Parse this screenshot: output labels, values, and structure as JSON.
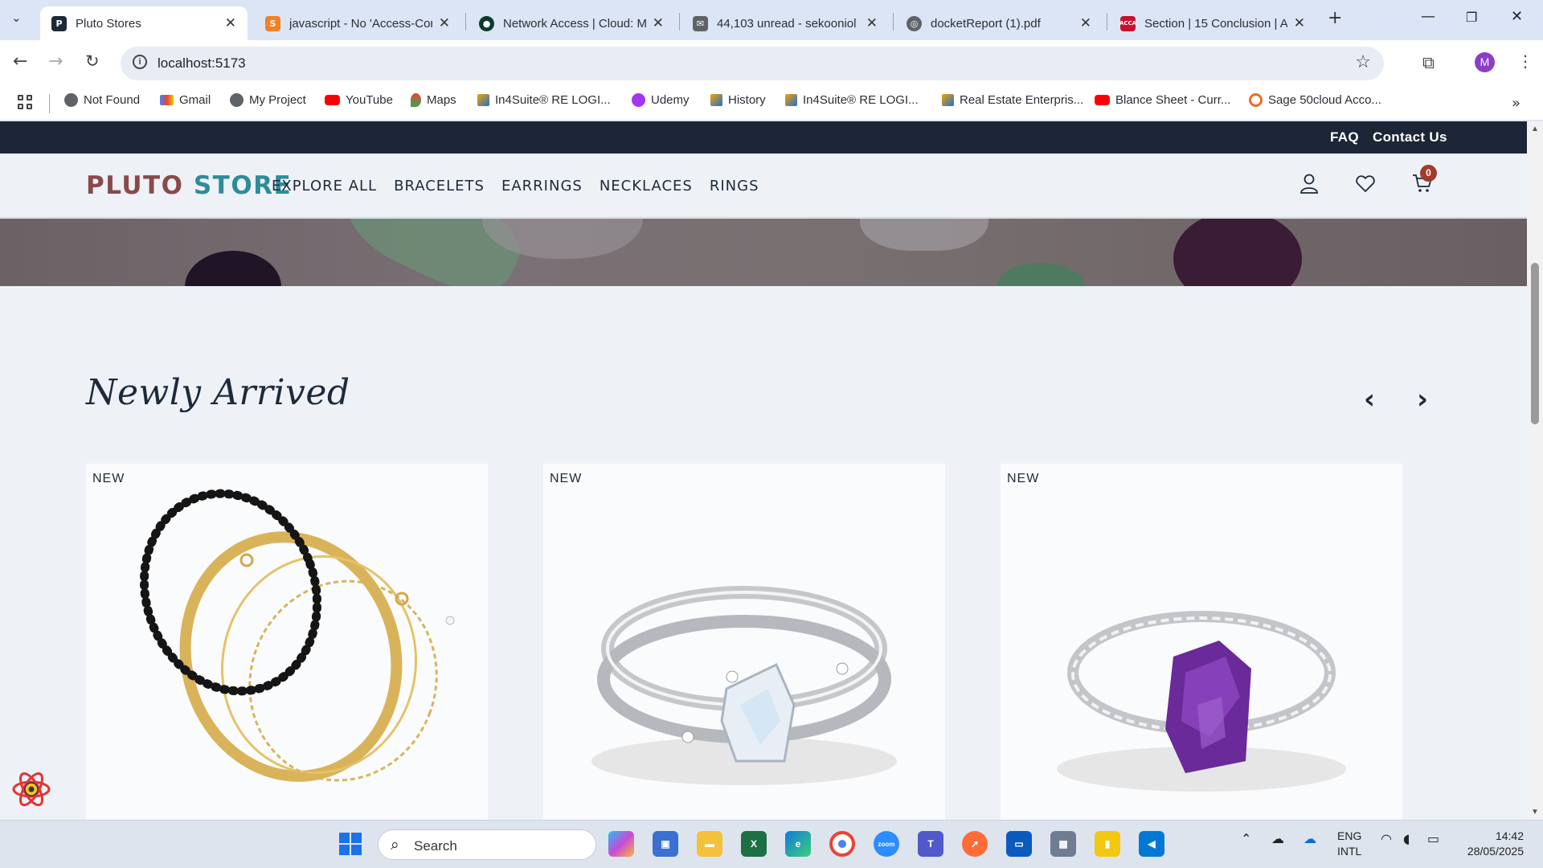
{
  "browser": {
    "tabs": [
      {
        "title": "Pluto Stores",
        "active": true,
        "icon": "pluto-favicon"
      },
      {
        "title": "javascript - No 'Access-Cor",
        "icon": "stackoverflow-favicon"
      },
      {
        "title": "Network Access | Cloud: M",
        "icon": "mongodb-favicon"
      },
      {
        "title": "44,103 unread - sekooniol",
        "icon": "mail-favicon"
      },
      {
        "title": "docketReport (1).pdf",
        "icon": "globe-favicon"
      },
      {
        "title": "Section | 15 Conclusion | A",
        "icon": "acca-favicon"
      }
    ],
    "new_tab": "+",
    "url": "localhost:5173",
    "profile_initial": "M",
    "bookmarks": [
      {
        "label": "Not Found",
        "icon": "globe-icon"
      },
      {
        "label": "Gmail",
        "icon": "gmail-icon"
      },
      {
        "label": "My Project",
        "icon": "globe-icon"
      },
      {
        "label": "YouTube",
        "icon": "youtube-icon"
      },
      {
        "label": "Maps",
        "icon": "maps-icon"
      },
      {
        "label": "In4Suite® RE LOGI...",
        "icon": "in4suite-icon"
      },
      {
        "label": "Udemy",
        "icon": "udemy-icon"
      },
      {
        "label": "History",
        "icon": "in4suite-icon"
      },
      {
        "label": "In4Suite® RE LOGI...",
        "icon": "in4suite-icon"
      },
      {
        "label": "Real Estate Enterpris...",
        "icon": "in4suite-icon"
      },
      {
        "label": "Blance Sheet - Curr...",
        "icon": "youtube-icon"
      },
      {
        "label": "Sage 50cloud Acco...",
        "icon": "sage-icon"
      }
    ]
  },
  "site": {
    "top_links": [
      "FAQ",
      "Contact Us"
    ],
    "logo_part1": "PLUTO",
    "logo_part2": "STORE",
    "nav": [
      "EXPLORE ALL",
      "BRACELETS",
      "EARRINGS",
      "NECKLACES",
      "RINGS"
    ],
    "cart_count": "0",
    "section_title": "Newly Arrived",
    "products": [
      {
        "badge": "NEW",
        "image": "gold-and-black-bead-bracelets"
      },
      {
        "badge": "NEW",
        "image": "silver-moonstone-ring"
      },
      {
        "badge": "NEW",
        "image": "silver-amethyst-ring"
      }
    ]
  },
  "taskbar": {
    "search_label": "Search",
    "lang_line1": "ENG",
    "lang_line2": "INTL",
    "time": "14:42",
    "date": "28/05/2025"
  },
  "colors": {
    "topstrip": "#1c2636",
    "logo_part1": "#8a4a4a",
    "logo_part2": "#2e8c99",
    "cart_badge": "#a13b2d"
  }
}
